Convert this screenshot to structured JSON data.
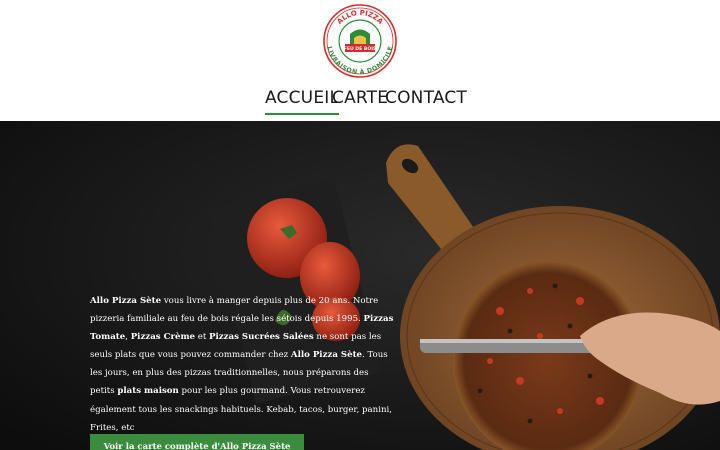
{
  "logo": {
    "top_text": "ALLO PIZZA",
    "badge_text": "FEU DE BOIS",
    "bottom_text": "LIVRAISON À DOMICILE",
    "colors": {
      "red": "#d62b2b",
      "green": "#2e8b3a"
    }
  },
  "nav": {
    "items": [
      {
        "label": "ACCUEIL",
        "active": true
      },
      {
        "label": "CARTE",
        "active": false
      },
      {
        "label": "CONTACT",
        "active": false
      }
    ],
    "active_color": "#2e8b3a"
  },
  "hero": {
    "paragraph": [
      {
        "t": "Allo Pizza Sète",
        "b": true
      },
      {
        "t": " vous livre à manger depuis plus de 20 ans. Notre pizzeria familiale au feu de bois régale les sétois depuis 1995. ",
        "b": false
      },
      {
        "t": "Pizzas Tomate",
        "b": true
      },
      {
        "t": ", ",
        "b": false
      },
      {
        "t": "Pizzas Crème",
        "b": true
      },
      {
        "t": " et ",
        "b": false
      },
      {
        "t": "Pizzas Sucrées Salées",
        "b": true
      },
      {
        "t": " ne sont pas les seuls plats que vous pouvez commander chez ",
        "b": false
      },
      {
        "t": "Allo Pizza Sète",
        "b": true
      },
      {
        "t": ". Tous les jours, en plus des pizzas traditionnelles, nous préparons des petits ",
        "b": false
      },
      {
        "t": "plats maison",
        "b": true
      },
      {
        "t": " pour les plus gourmand. Vous retrouverez également tous les snackings habituels. Kebab, tacos, burger, panini, Frites, etc",
        "b": false
      }
    ],
    "cta_label": "Voir la carte complète d'Allo Pizza Sète",
    "cta_color": "#3c8c40"
  }
}
